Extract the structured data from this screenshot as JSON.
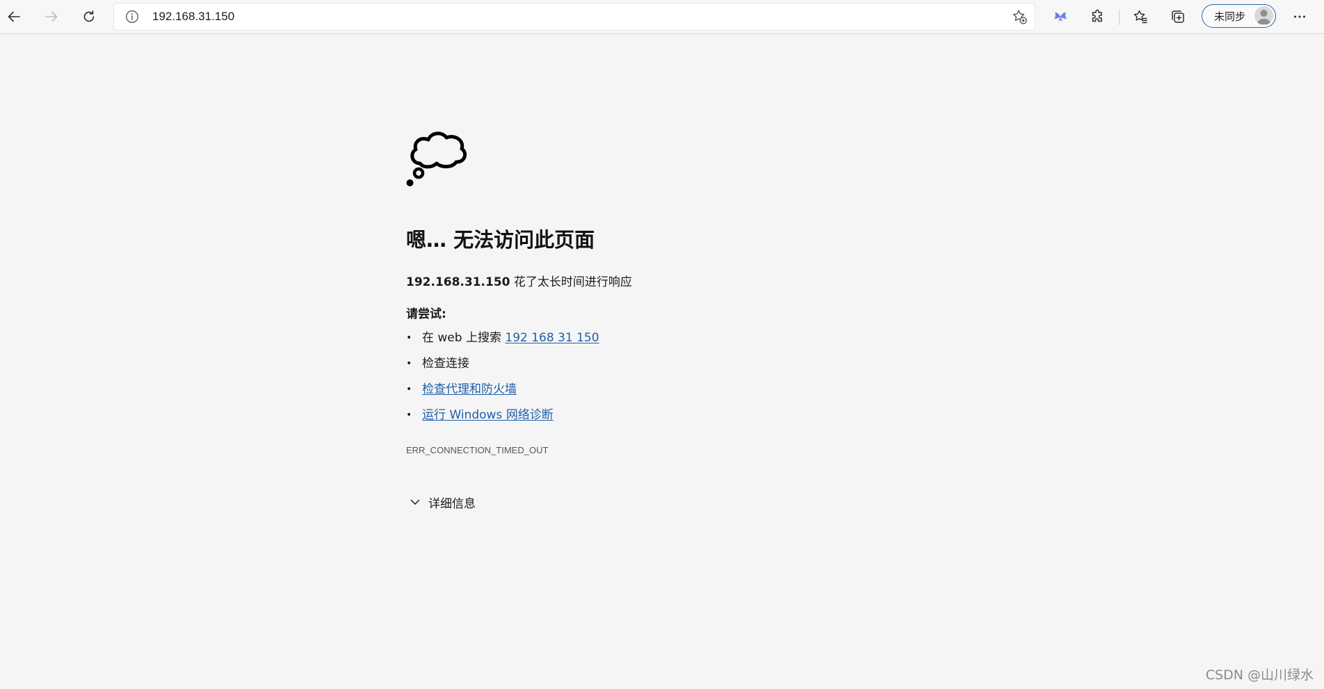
{
  "browser": {
    "url": "192.168.31.150",
    "profile_label": "未同步",
    "icons": {
      "back": "back-arrow-icon",
      "forward": "forward-arrow-icon",
      "refresh": "refresh-icon",
      "site_info": "info-icon",
      "add_favorite": "add-favorite-icon",
      "copilot": "copilot-icon",
      "extensions": "puzzle-icon",
      "favorites": "favorites-star-icon",
      "collections": "collections-icon",
      "profile": "avatar-icon",
      "menu": "more-icon"
    },
    "accent_color": "#2a62a8"
  },
  "error_page": {
    "heading": "嗯… 无法访问此页面",
    "host": "192.168.31.150",
    "reason_text": " 花了太长时间进行响应",
    "try_label": "请尝试:",
    "suggestions": [
      {
        "prefix": "在 web 上搜索 ",
        "link": "192 168 31 150"
      },
      {
        "text": "检查连接"
      },
      {
        "link": "检查代理和防火墙"
      },
      {
        "link": "运行 Windows 网络诊断"
      }
    ],
    "bullet": "•",
    "error_code": "ERR_CONNECTION_TIMED_OUT",
    "details_label": "详细信息",
    "link_color": "#1f5ea8",
    "icon": "thought-cloud-icon"
  },
  "watermark": "CSDN @山川绿水"
}
